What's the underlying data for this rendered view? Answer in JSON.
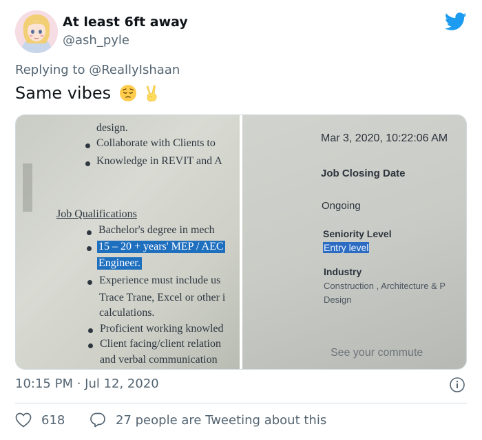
{
  "author": {
    "display_name": "At least 6ft away",
    "handle": "@ash_pyle",
    "avatar_icon": "anime-avatar",
    "brand_icon": "twitter-bird-icon",
    "brand_color": "#1d9bf0"
  },
  "reply": {
    "prefix": "Replying to",
    "mention": "@ReallyIshaan"
  },
  "tweet": {
    "text": "Same vibes",
    "emojis": [
      "pensive-face-emoji",
      "victory-hand-emoji"
    ]
  },
  "photos": {
    "left": {
      "line_design": "design.",
      "line_collab": "Collaborate with Clients to",
      "line_knowledge": "Knowledge in REVIT and A",
      "heading": "Job Qualifications",
      "line_bachelor": "Bachelor's degree in mech",
      "line_years": "15 – 20 + years' MEP / AEC",
      "line_engineer": "Engineer.",
      "line_experience": "Experience must include us",
      "line_trace": "Trace Trane, Excel or other i",
      "line_calc": "calculations.",
      "line_proficient": "Proficient working knowled",
      "line_client": "Client facing/client relation",
      "line_verbal": "and verbal communication"
    },
    "right": {
      "date": "Mar 3, 2020, 10:22:06 AM",
      "closing_label": "Job Closing Date",
      "closing_value": "Ongoing",
      "seniority_label": "Seniority Level",
      "seniority_value": "Entry level",
      "industry_label": "Industry",
      "industry_value_1": "Construction , Architecture & P",
      "industry_value_2": "Design",
      "commute": "See your commute"
    }
  },
  "meta": {
    "timestamp": "10:15 PM · Jul 12, 2020"
  },
  "stats": {
    "likes": "618",
    "tweeting": "27 people are Tweeting about this"
  }
}
